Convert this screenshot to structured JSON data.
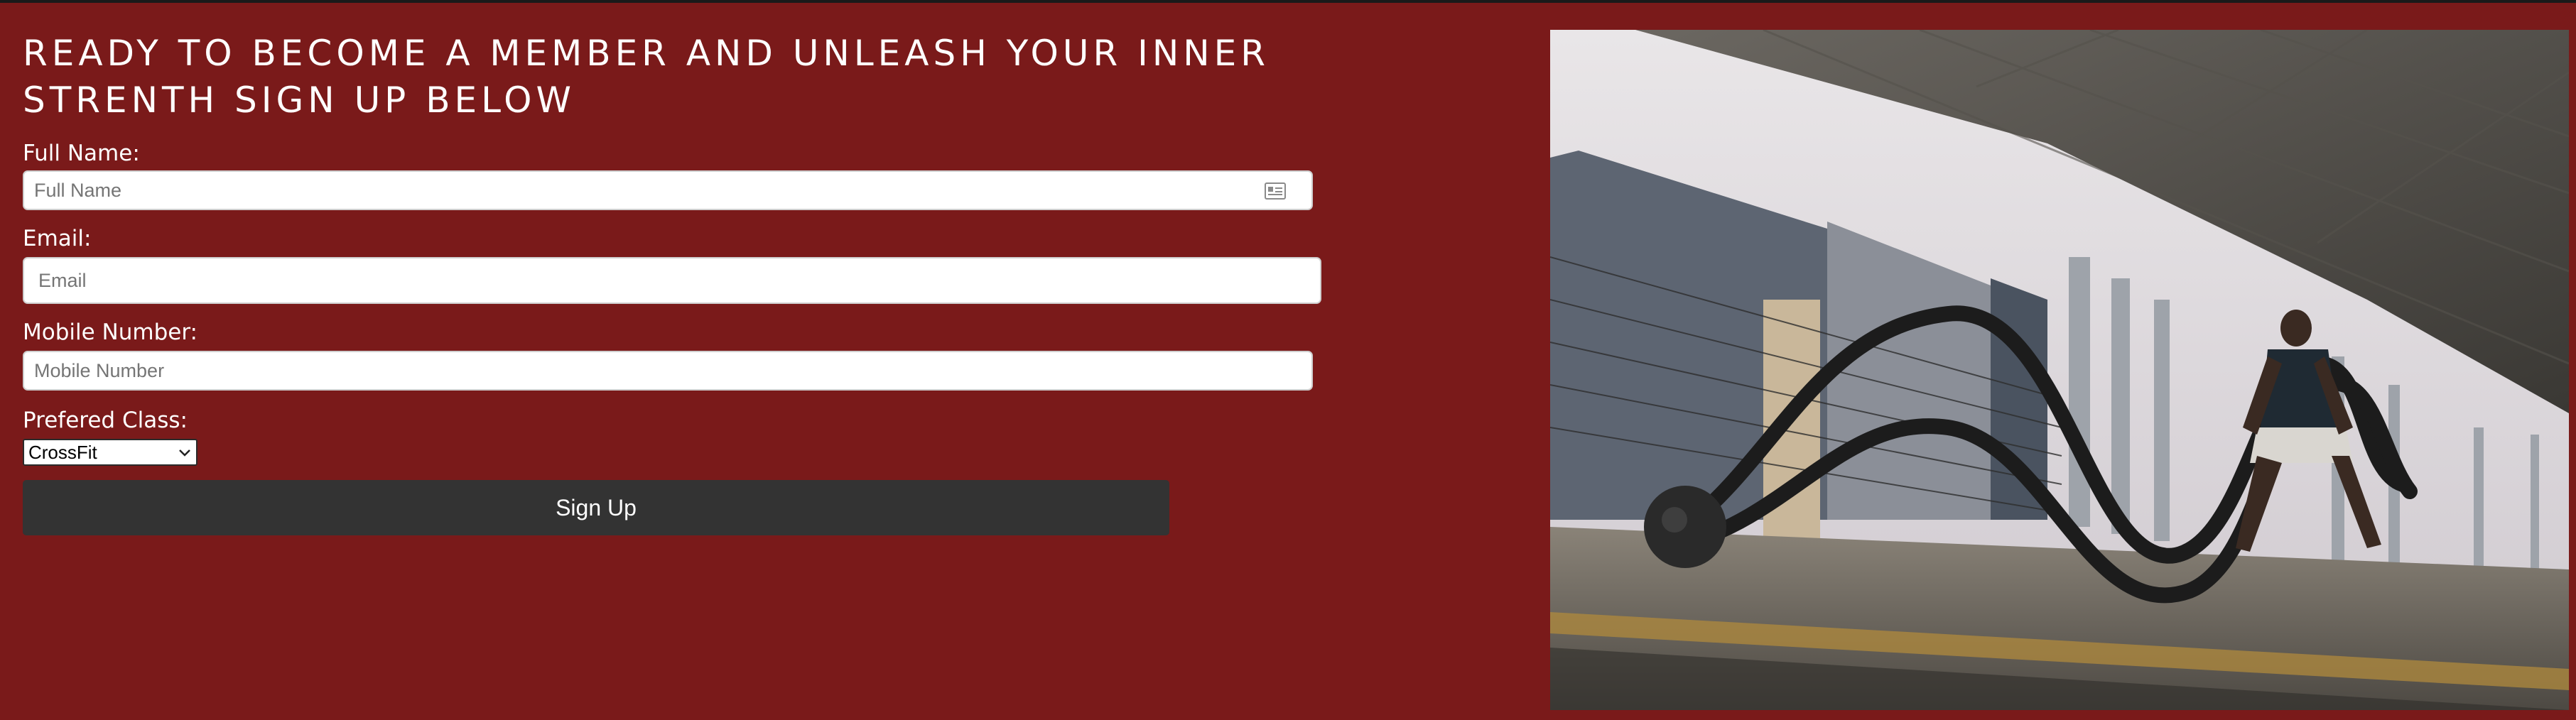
{
  "heading": "READY TO BECOME A MEMBER AND UNLEASH YOUR INNER STRENTH SIGN UP BELOW",
  "form": {
    "full_name_label": "Full Name:",
    "full_name_placeholder": "Full Name",
    "email_label": "Email:",
    "email_placeholder": "Email",
    "mobile_label": "Mobile Number:",
    "mobile_placeholder": "Mobile Number",
    "class_label": "Prefered Class:",
    "class_selected": "CrossFit",
    "submit_label": "Sign Up"
  },
  "icons": {
    "name_field_icon": "contact-card-icon",
    "select_icon": "chevron-down-icon"
  },
  "colors": {
    "background": "#7a1a1a",
    "button": "#333333",
    "text": "#ffffff"
  }
}
